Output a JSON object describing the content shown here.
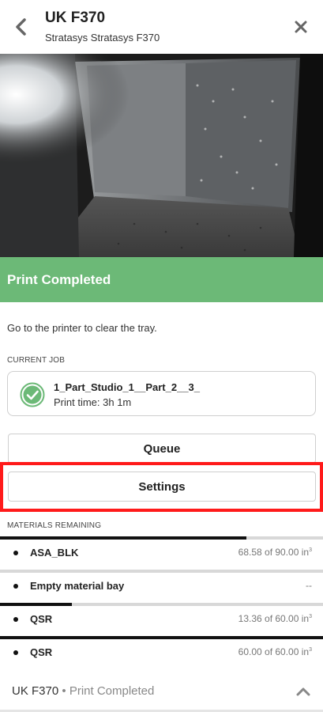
{
  "header": {
    "title": "UK F370",
    "subtitle": "Stratasys Stratasys F370",
    "back_icon": "chevron-left-icon",
    "close_icon": "close-icon"
  },
  "status": {
    "label": "Print Completed",
    "color": "#6cb977"
  },
  "instruction": "Go to the printer to clear the tray.",
  "current_job": {
    "section_label": "CURRENT JOB",
    "name": "1_Part_Studio_1__Part_2__3_",
    "time": "Print time: 3h 1m",
    "icon": "check-circle-icon"
  },
  "buttons": {
    "queue_label": "Queue",
    "settings_label": "Settings"
  },
  "materials": {
    "section_label": "MATERIALS REMAINING",
    "items": [
      {
        "name": "ASA_BLK",
        "amount": "68.58 of 90.00 in",
        "unit_sup": "3",
        "fraction": 0.762
      },
      {
        "name": "Empty material bay",
        "amount": "--",
        "unit_sup": "",
        "fraction": 0
      },
      {
        "name": "QSR",
        "amount": "13.36 of 60.00 in",
        "unit_sup": "3",
        "fraction": 0.223
      },
      {
        "name": "QSR",
        "amount": "60.00 of 60.00 in",
        "unit_sup": "3",
        "fraction": 1.0
      }
    ]
  },
  "footer": {
    "printer": "UK F370",
    "separator": "•",
    "status": "Print Completed",
    "toggle_icon": "chevron-up-icon"
  }
}
